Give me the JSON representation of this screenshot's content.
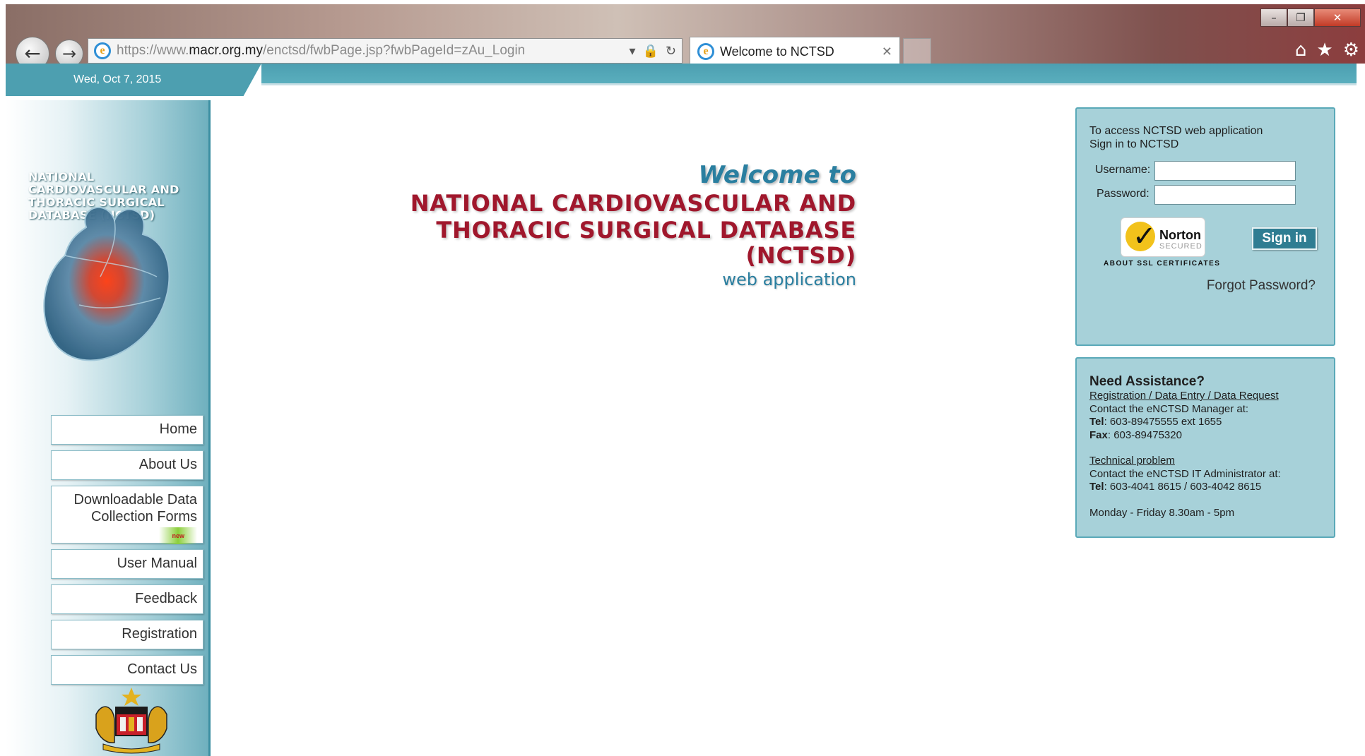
{
  "browser": {
    "url_prefix": "https://www.",
    "url_domain": "macr.org.my",
    "url_path": "/enctsd/fwbPage.jsp?fwbPageId=zAu_Login",
    "tab_title": "Welcome to NCTSD"
  },
  "header": {
    "date": "Wed, Oct 7, 2015"
  },
  "sidebar": {
    "logo_text": "NATIONAL CARDIOVASCULAR AND THORACIC SURGICAL DATABASE (NCTSD)",
    "menu": [
      {
        "label": "Home"
      },
      {
        "label": "About Us"
      },
      {
        "label": "Downloadable Data Collection Forms",
        "badge": "new"
      },
      {
        "label": "User Manual"
      },
      {
        "label": "Feedback"
      },
      {
        "label": "Registration"
      },
      {
        "label": "Contact Us"
      }
    ]
  },
  "welcome": {
    "line1": "Welcome to",
    "line2": "NATIONAL CARDIOVASCULAR AND",
    "line3": "THORACIC SURGICAL DATABASE (NCTSD)",
    "line4": "web application"
  },
  "login": {
    "intro_line1": "To access NCTSD web application",
    "intro_line2": "Sign in to NCTSD",
    "username_label": "Username:",
    "password_label": "Password:",
    "username_value": "",
    "password_value": "",
    "norton_name": "Norton",
    "norton_secured": "SECURED",
    "norton_about": "ABOUT SSL CERTIFICATES",
    "sign_in": "Sign in",
    "forgot": "Forgot Password?"
  },
  "assistance": {
    "title": "Need Assistance?",
    "reg_link": "Registration / Data Entry / Data Request",
    "reg_contact": "Contact the eNCTSD Manager at:",
    "reg_tel_label": "Tel",
    "reg_tel": ": 603-89475555 ext 1655",
    "reg_fax_label": "Fax",
    "reg_fax": ": 603-89475320",
    "tech_link": "Technical problem",
    "tech_contact": "Contact the eNCTSD IT Administrator at:",
    "tech_tel_label": "Tel",
    "tech_tel": ": 603-4041 8615 / 603-4042 8615",
    "hours": "Monday - Friday 8.30am - 5pm"
  },
  "colors": {
    "accent_teal": "#4d9fb0",
    "panel_bg": "#a7d1d9",
    "title_red": "#a0172c",
    "welcome_blue": "#2a7fa0"
  },
  "icons": {
    "back": "back-arrow-icon",
    "forward": "forward-arrow-icon",
    "lock": "lock-icon",
    "refresh": "refresh-icon",
    "home": "home-icon",
    "favorites": "star-icon",
    "settings": "gear-icon"
  }
}
